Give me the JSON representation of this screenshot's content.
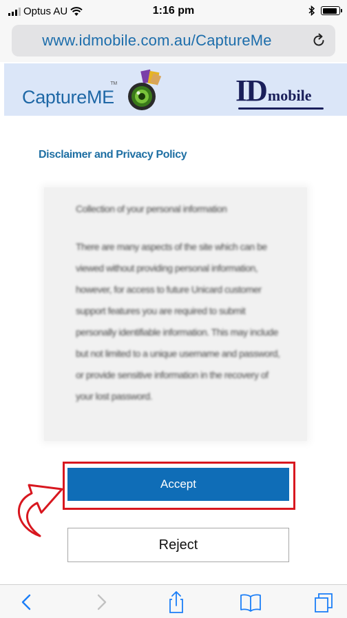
{
  "status_bar": {
    "carrier": "Optus AU",
    "time": "1:16 pm",
    "icons": [
      "signal-icon",
      "wifi-icon",
      "bluetooth-icon",
      "battery-icon"
    ]
  },
  "browser": {
    "url": "www.idmobile.com.au/CaptureMe",
    "reload_icon": "reload-icon",
    "accent_color": "#1c6dab"
  },
  "header": {
    "capture_logo_text": "CaptureME",
    "capture_logo_tm": "TM",
    "idmobile_logo_big": "ID",
    "idmobile_logo_small": "mobile",
    "background_color": "#dbe6f8"
  },
  "policy": {
    "heading": "Disclaimer and Privacy Policy",
    "paragraph_1": "Collection of your personal information",
    "paragraph_2": "There are many aspects of the site which can be viewed without providing personal information, however, for access to future Unicard customer support features you are required to submit personally identifiable information. This may include but not limited to a unique username and password, or provide sensitive information in the recovery of your lost password."
  },
  "actions": {
    "accept_label": "Accept",
    "reject_label": "Reject",
    "accept_color": "#0f6db7",
    "highlight_color": "#d8171f",
    "pointer_icon": "curved-arrow-icon"
  },
  "toolbar": {
    "icons": [
      "back-icon",
      "forward-icon",
      "share-icon",
      "bookmarks-icon",
      "tabs-icon"
    ]
  }
}
